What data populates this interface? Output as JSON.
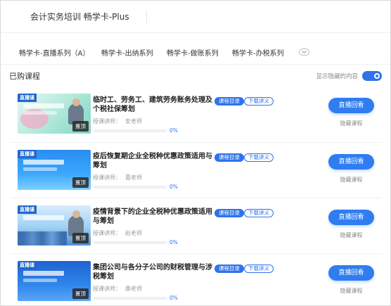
{
  "header": {
    "title": "会计实务培训 畅学卡-Plus"
  },
  "tabs": [
    {
      "label": "畅学卡-直播系列（A）"
    },
    {
      "label": "畅学卡-出纳系列"
    },
    {
      "label": "畅学卡-做账系列"
    },
    {
      "label": "畅学卡-办税系列"
    }
  ],
  "more_icon": "chevron-down-icon",
  "section": {
    "title": "已购课程",
    "toggle_label": "显示隐藏的内容",
    "toggle_on": true
  },
  "course_labels": {
    "tag": "直播课",
    "pin": "置顶",
    "directory": "课程目录",
    "download": "下载讲义",
    "teacher_prefix": "授课讲师：",
    "play": "直播回看",
    "hide": "隐藏课程"
  },
  "courses": [
    {
      "title": "临时工、劳务工、建筑劳务账务处理及个税社保筹划",
      "teacher": "安老师",
      "progress": "0%",
      "progress_value": 0
    },
    {
      "title": "疫后恢复期企业全税种优惠政策适用与筹划",
      "teacher": "葛老师",
      "progress": "0%",
      "progress_value": 0
    },
    {
      "title": "疫情背景下的企业全税种优惠政策适用与筹划",
      "teacher": "赵老师",
      "progress": "0%",
      "progress_value": 0
    },
    {
      "title": "集团公司与各分子公司的财税管理与涉税筹划",
      "teacher": "桑老师",
      "progress": "0%",
      "progress_value": 0
    }
  ],
  "colors": {
    "accent": "#2f74e9",
    "button": "#2f7df0"
  }
}
